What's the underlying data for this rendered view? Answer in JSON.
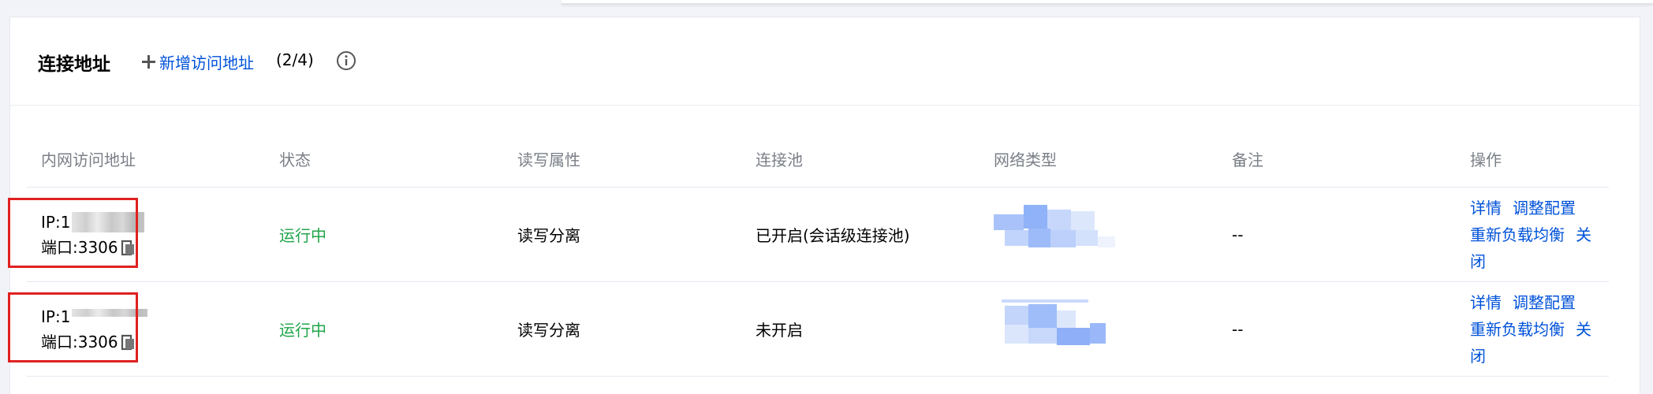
{
  "section": {
    "title": "连接地址",
    "add_label": "新增访问地址",
    "count": "(2/4)"
  },
  "table": {
    "headers": [
      "内网访问地址",
      "状态",
      "读写属性",
      "连接池",
      "网络类型",
      "备注",
      "操作"
    ],
    "rows": [
      {
        "ip_label": "IP:1",
        "port_label": "端口:3306",
        "status": "运行中",
        "rw": "读写分离",
        "pool": "已开启(会话级连接池)",
        "note": "--",
        "ops": [
          "详情",
          "调整配置",
          "重新负载均衡",
          "关闭"
        ]
      },
      {
        "ip_label": "IP:1",
        "port_label": "端口:3306",
        "status": "运行中",
        "rw": "读写分离",
        "pool": "未开启",
        "note": "--",
        "ops": [
          "详情",
          "调整配置",
          "重新负载均衡",
          "关闭"
        ]
      }
    ]
  },
  "icons": {
    "add": "plus-icon",
    "info": "info-circle-icon",
    "copy": "copy-icon"
  },
  "colors": {
    "link": "#0052d9",
    "running": "#1fa549",
    "highlight_box": "#e02020",
    "header_text": "#7a7f87"
  }
}
